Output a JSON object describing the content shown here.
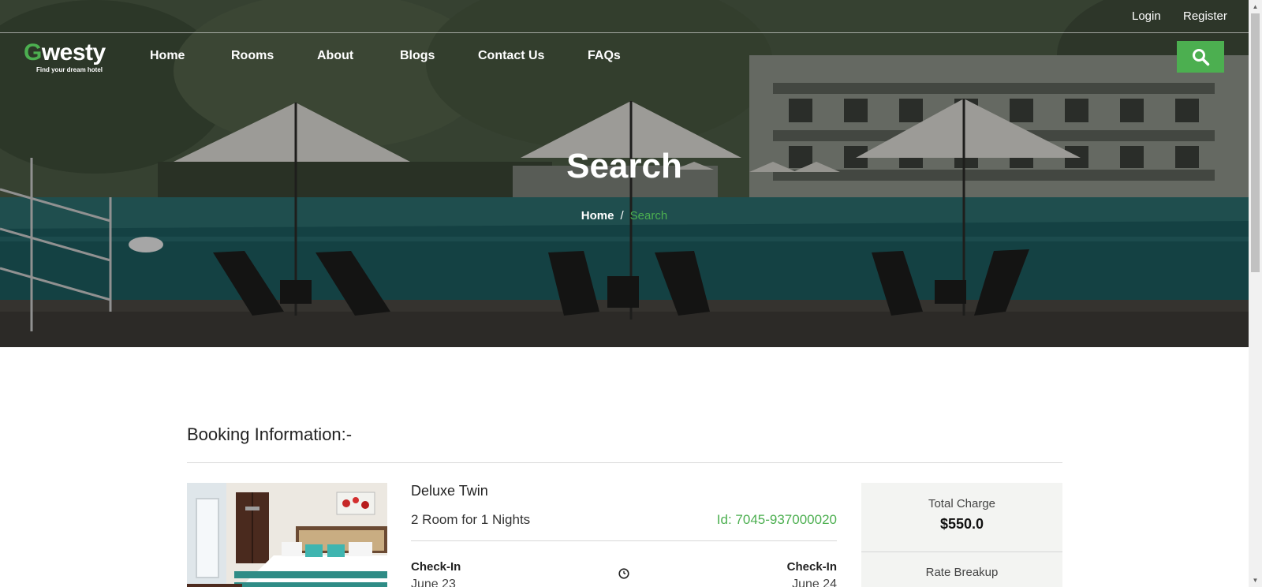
{
  "topbar": {
    "login": "Login",
    "register": "Register"
  },
  "brand": {
    "first_letter": "G",
    "rest": "westy",
    "tagline": "Find your dream hotel"
  },
  "nav": {
    "items": [
      {
        "label": "Home"
      },
      {
        "label": "Rooms"
      },
      {
        "label": "About"
      },
      {
        "label": "Blogs"
      },
      {
        "label": "Contact Us"
      },
      {
        "label": "FAQs"
      }
    ],
    "search_icon": "search-icon"
  },
  "hero": {
    "title": "Search",
    "breadcrumb": {
      "home": "Home",
      "separator": "/",
      "current": "Search"
    }
  },
  "booking": {
    "title": "Booking Information:-",
    "room_name": "Deluxe Twin",
    "rooms_nights": "2 Room for 1 Nights",
    "booking_id": "Id: 7045-937000020",
    "checkin_label": "Check-In",
    "checkin_date": "June 23",
    "checkout_label": "Check-In",
    "checkout_date": "June 24"
  },
  "charges": {
    "total_label": "Total Charge",
    "total_amount": "$550.0",
    "rate_breakup": "Rate Breakup"
  },
  "colors": {
    "accent": "#4caf50",
    "text": "#222222",
    "panel": "#f3f4f2"
  }
}
